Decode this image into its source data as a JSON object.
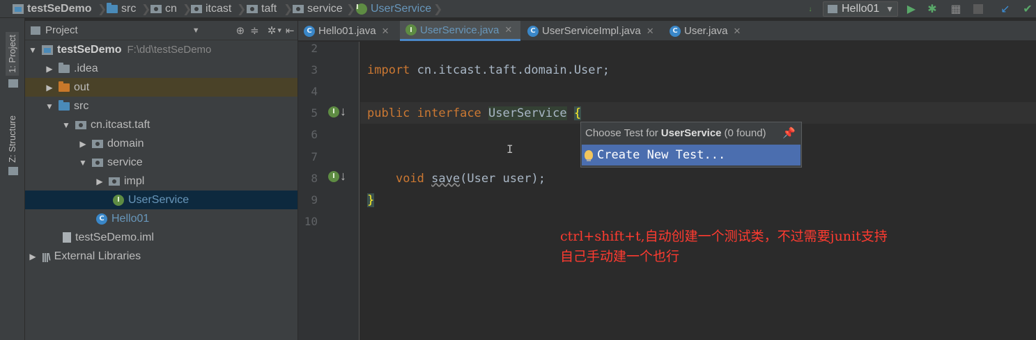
{
  "breadcrumbs": [
    {
      "label": "testSeDemo",
      "icon": "project-icon"
    },
    {
      "label": "src",
      "icon": "folder-icon"
    },
    {
      "label": "cn",
      "icon": "package-icon"
    },
    {
      "label": "itcast",
      "icon": "package-icon"
    },
    {
      "label": "taft",
      "icon": "package-icon"
    },
    {
      "label": "service",
      "icon": "package-icon"
    },
    {
      "label": "UserService",
      "icon": "interface-icon"
    }
  ],
  "toolbar": {
    "run_config": "Hello01",
    "icons": [
      "binary-icon",
      "run-icon",
      "debug-icon",
      "coverage-icon",
      "stop-icon",
      "vcs-update-icon",
      "vcs-commit-icon"
    ]
  },
  "left_stripe": {
    "project_tab": "1: Project",
    "structure_tab": "Z: Structure"
  },
  "project_panel": {
    "title": "Project",
    "tree": [
      {
        "label": "testSeDemo",
        "extra": "F:\\dd\\testSeDemo",
        "icon": "project-icon",
        "arrow": "▼"
      },
      {
        "label": ".idea",
        "icon": "folder-icon",
        "arrow": "▶"
      },
      {
        "label": "out",
        "icon": "folder-icon",
        "arrow": "▶"
      },
      {
        "label": "src",
        "icon": "folder-icon",
        "arrow": "▼"
      },
      {
        "label": "cn.itcast.taft",
        "icon": "package-icon",
        "arrow": "▼"
      },
      {
        "label": "domain",
        "icon": "package-icon",
        "arrow": "▶"
      },
      {
        "label": "service",
        "icon": "package-icon",
        "arrow": "▼"
      },
      {
        "label": "impl",
        "icon": "package-icon",
        "arrow": "▶"
      },
      {
        "label": "UserService",
        "icon": "interface-icon",
        "arrow": ""
      },
      {
        "label": "Hello01",
        "icon": "class-icon",
        "arrow": ""
      },
      {
        "label": "testSeDemo.iml",
        "icon": "file-icon",
        "arrow": ""
      },
      {
        "label": "External Libraries",
        "icon": "library-icon",
        "arrow": "▶"
      }
    ]
  },
  "tabs": [
    {
      "label": "Hello01.java",
      "icon": "class-icon",
      "active": false
    },
    {
      "label": "UserService.java",
      "icon": "interface-icon",
      "active": true
    },
    {
      "label": "UserServiceImpl.java",
      "icon": "class-icon",
      "active": false
    },
    {
      "label": "User.java",
      "icon": "class-icon",
      "active": false
    }
  ],
  "editor": {
    "line_numbers": [
      "2",
      "3",
      "4",
      "5",
      "6",
      "7",
      "8",
      "9",
      "10"
    ],
    "import_kw": "import",
    "import_path": " cn.itcast.taft.domain.User;",
    "public_kw": "public",
    "interface_kw": "interface",
    "iface_name": "UserService",
    "open_brace": "{",
    "void_kw": "void",
    "method_name": "save",
    "method_params": "(User user);",
    "close_brace": "}"
  },
  "popup": {
    "title_prefix": "Choose Test for",
    "title_name": "UserService",
    "title_suffix": "(0 found)",
    "item": "Create New Test..."
  },
  "annotation": {
    "line1": "ctrl+shift+t,自动创建一个测试类，不过需要junit支持",
    "line2": "自己手动建一个也行"
  }
}
